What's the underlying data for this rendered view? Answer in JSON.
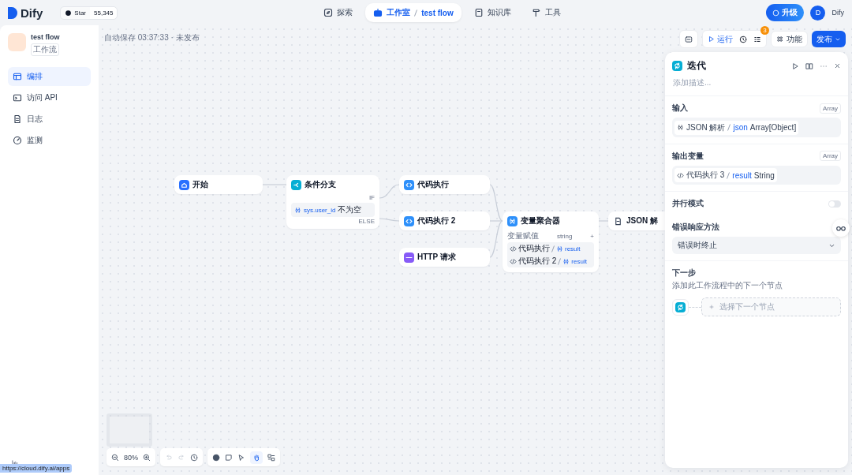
{
  "header": {
    "logo": "Dify",
    "github": {
      "label": "Star",
      "count": "55,345"
    },
    "nav": [
      {
        "label": "探索",
        "selected": false
      },
      {
        "label": "工作室",
        "selected": true,
        "crumb": "test flow"
      },
      {
        "label": "知识库",
        "selected": false
      },
      {
        "label": "工具",
        "selected": false
      }
    ],
    "upgrade": "升级",
    "avatar": "D",
    "user": "Dify"
  },
  "sidebar": {
    "app_name": "test flow",
    "app_type": "工作流",
    "items": [
      {
        "label": "编排",
        "selected": true
      },
      {
        "label": "访问 API",
        "selected": false
      },
      {
        "label": "日志",
        "selected": false
      },
      {
        "label": "监测",
        "selected": false
      }
    ]
  },
  "canvas": {
    "status": "自动保存 03:37:33 · 未发布",
    "toolbar": {
      "run": "运行",
      "badge": "3",
      "features": "功能",
      "publish": "发布"
    },
    "nodes": [
      {
        "kind": "start",
        "title": "开始"
      },
      {
        "kind": "if",
        "title": "条件分支",
        "if_label": "IF",
        "variable": "sys.user_id",
        "operator": "不为空",
        "else_label": "ELSE"
      },
      {
        "kind": "code",
        "title": "代码执行"
      },
      {
        "kind": "code",
        "title": "代码执行 2"
      },
      {
        "kind": "http",
        "title": "HTTP 请求"
      },
      {
        "kind": "aggregator",
        "title": "变量聚合器",
        "label": "变量赋值",
        "type": "string",
        "add": "+",
        "items": [
          {
            "source": "代码执行",
            "var": "result"
          },
          {
            "source": "代码执行 2",
            "var": "result"
          }
        ]
      },
      {
        "kind": "json",
        "title": "JSON 解"
      }
    ],
    "zoom": "80%"
  },
  "panel": {
    "title": "迭代",
    "description": "添加描述...",
    "input": {
      "label": "输入",
      "type": "Array",
      "source": "JSON 解析",
      "var": "json",
      "var_type": "Array[Object]"
    },
    "output": {
      "label": "输出变量",
      "type": "Array",
      "source": "代码执行 3",
      "var": "result",
      "var_type": "String"
    },
    "parallel": {
      "label": "并行模式",
      "on": false
    },
    "error": {
      "label": "错误响应方法",
      "value": "错误时终止"
    },
    "next": {
      "label": "下一步",
      "hint": "添加此工作流程中的下一个节点",
      "placeholder": "选择下一个节点"
    }
  },
  "status_url": "https://cloud.dify.ai/apps"
}
